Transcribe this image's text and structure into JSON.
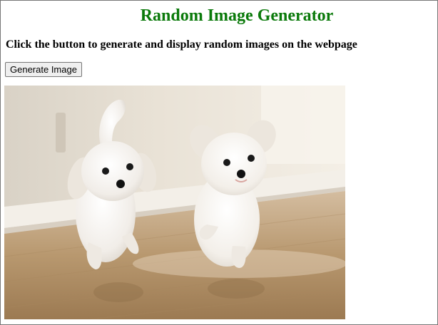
{
  "page": {
    "title": "Random Image Generator",
    "subtitle": "Click the button to generate and display random images on the webpage",
    "button_label": "Generate Image"
  },
  "image": {
    "subject": "two white puppies running on a wooden floor"
  },
  "colors": {
    "title_green": "#0b7a0b",
    "button_bg": "#efefef",
    "frame_border": "#767676"
  }
}
